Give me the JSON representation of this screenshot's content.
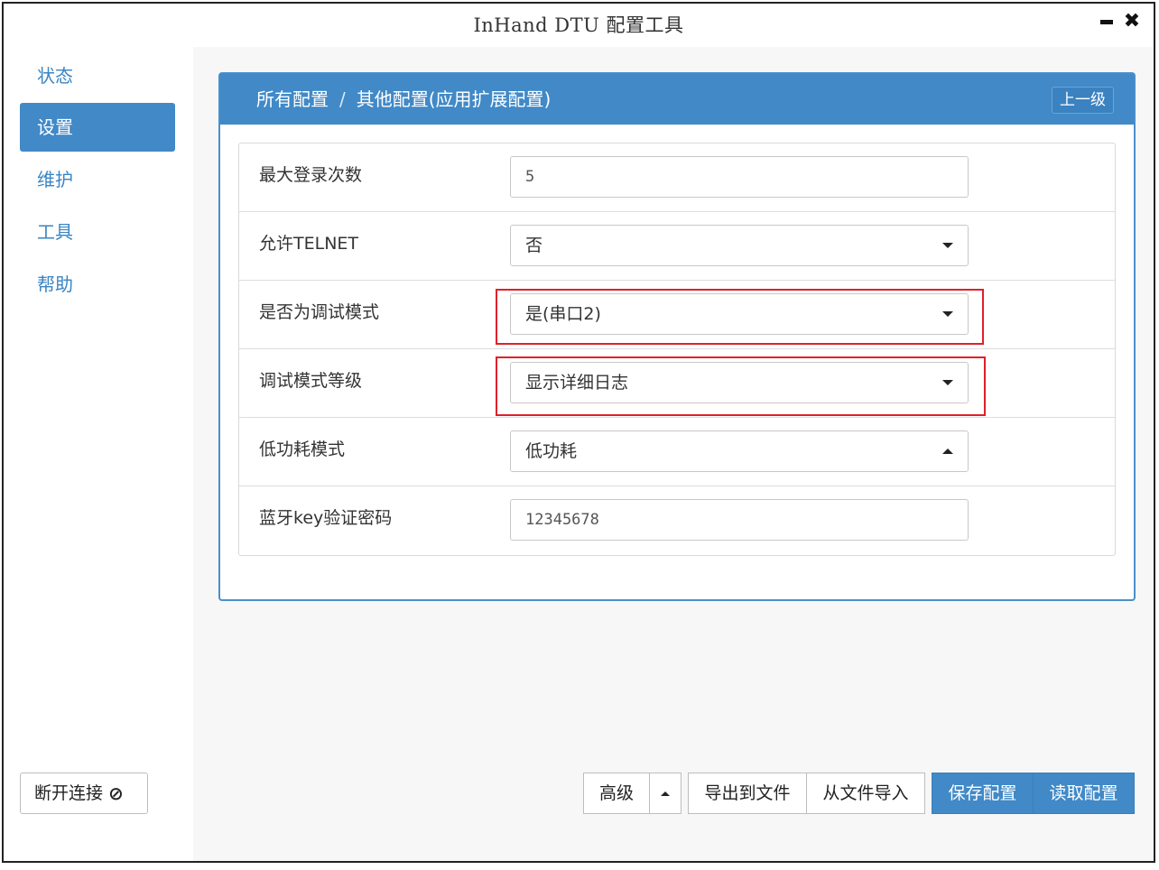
{
  "window": {
    "title": "InHand DTU 配置工具",
    "minimize_icon": "minimize-icon",
    "close_icon": "close-icon"
  },
  "sidebar": {
    "items": [
      {
        "label": "状态",
        "active": false
      },
      {
        "label": "设置",
        "active": true
      },
      {
        "label": "维护",
        "active": false
      },
      {
        "label": "工具",
        "active": false
      },
      {
        "label": "帮助",
        "active": false
      }
    ],
    "disconnect_label": "断开连接",
    "disconnect_icon": "ban-icon"
  },
  "panel": {
    "breadcrumb": [
      "所有配置",
      "其他配置(应用扩展配置)"
    ],
    "separator": "/",
    "up_button": "上一级"
  },
  "form": {
    "rows": [
      {
        "label": "最大登录次数",
        "value": "5",
        "type": "input"
      },
      {
        "label": "允许TELNET",
        "value": "否",
        "type": "select"
      },
      {
        "label": "是否为调试模式",
        "value": "是(串口2)",
        "type": "select",
        "highlighted": true
      },
      {
        "label": "调试模式等级",
        "value": "显示详细日志",
        "type": "select",
        "highlighted": true
      },
      {
        "label": "低功耗模式",
        "value": "低功耗",
        "type": "select",
        "open": true
      },
      {
        "label": "蓝牙key验证密码",
        "value": "12345678",
        "type": "input"
      }
    ]
  },
  "footer": {
    "advanced": "高级",
    "export": "导出到文件",
    "import": "从文件导入",
    "save": "保存配置",
    "read": "读取配置"
  },
  "colors": {
    "accent": "#4189c7",
    "highlight": "#e0202a"
  }
}
